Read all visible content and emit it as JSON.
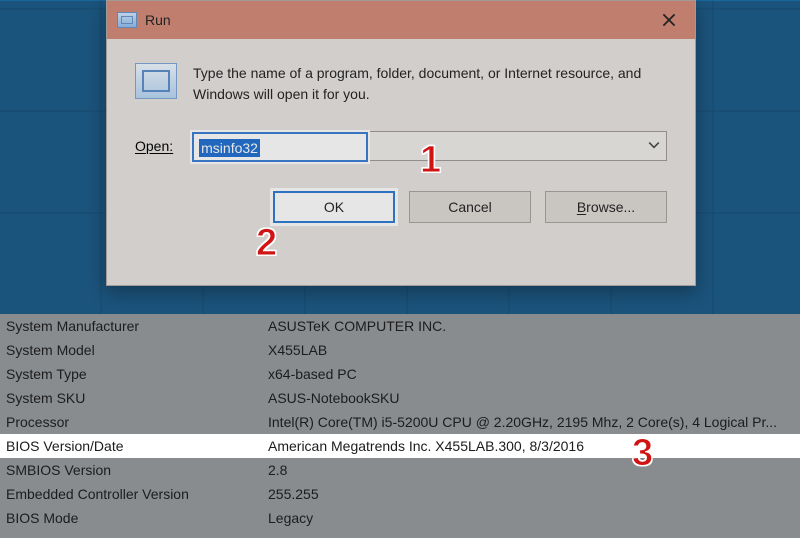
{
  "run_dialog": {
    "title": "Run",
    "prompt": "Type the name of a program, folder, document, or Internet resource, and Windows will open it for you.",
    "open_label": "Open:",
    "input_value": "msinfo32",
    "buttons": {
      "ok": "OK",
      "cancel": "Cancel",
      "browse": "Browse..."
    },
    "browse_underline_char": "B",
    "open_underline_char": "O"
  },
  "msinfo_rows": [
    {
      "key": "System Manufacturer",
      "value": "ASUSTeK COMPUTER INC."
    },
    {
      "key": "System Model",
      "value": "X455LAB"
    },
    {
      "key": "System Type",
      "value": "x64-based PC"
    },
    {
      "key": "System SKU",
      "value": "ASUS-NotebookSKU"
    },
    {
      "key": "Processor",
      "value": "Intel(R) Core(TM) i5-5200U CPU @ 2.20GHz, 2195 Mhz, 2 Core(s), 4 Logical Pr..."
    },
    {
      "key": "BIOS Version/Date",
      "value": "American Megatrends Inc. X455LAB.300, 8/3/2016",
      "highlight": true
    },
    {
      "key": "SMBIOS Version",
      "value": "2.8"
    },
    {
      "key": "Embedded Controller Version",
      "value": "255.255"
    },
    {
      "key": "BIOS Mode",
      "value": "Legacy"
    }
  ],
  "annotations": {
    "one": "1",
    "two": "2",
    "three": "3"
  }
}
